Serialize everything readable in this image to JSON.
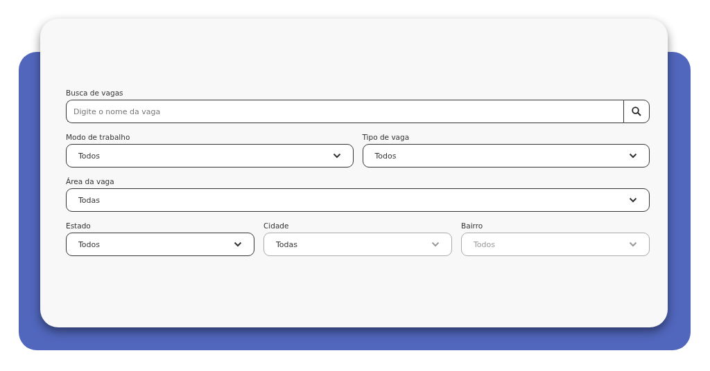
{
  "search": {
    "label": "Busca de vagas",
    "placeholder": "Digite o nome da vaga"
  },
  "filter_rows": [
    {
      "fields": [
        {
          "label": "Modo de trabalho",
          "value": "Todos",
          "disabled": false
        },
        {
          "label": "Tipo de vaga",
          "value": "Todos",
          "disabled": false
        }
      ]
    },
    {
      "fields": [
        {
          "label": "Área da vaga",
          "value": "Todas",
          "disabled": false
        }
      ]
    },
    {
      "fields": [
        {
          "label": "Estado",
          "value": "Todos",
          "disabled": false
        },
        {
          "label": "Cidade",
          "value": "Todas",
          "disabled": true
        },
        {
          "label": "Bairro",
          "placeholder": "Todos",
          "disabled": true
        }
      ]
    }
  ]
}
